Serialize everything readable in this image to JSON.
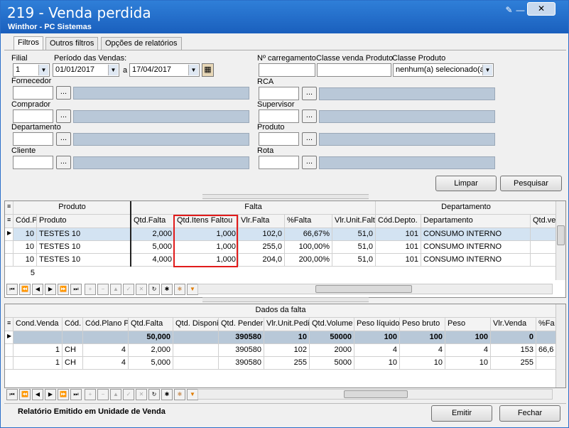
{
  "window": {
    "title": "219 - Venda perdida",
    "subtitle": "Winthor - PC Sistemas",
    "close_label": "✕"
  },
  "tabs": [
    {
      "label": "Filtros"
    },
    {
      "label": "Outros filtros"
    },
    {
      "label": "Opções de relatórios"
    }
  ],
  "filters": {
    "filial_label": "Filial",
    "filial_value": "1",
    "periodo_label": "Período das Vendas:",
    "data_inicio": "01/01/2017",
    "periodo_sep": "a",
    "data_fim": "17/04/2017",
    "fornecedor_label": "Fornecedor",
    "comprador_label": "Comprador",
    "departamento_label": "Departamento",
    "cliente_label": "Cliente",
    "carregamento_label": "Nº carregamento",
    "classe_venda_label": "Classe venda Produto",
    "classe_produto_label": "Classe Produto",
    "classe_produto_value": "nenhum(a) selecionado(a",
    "rca_label": "RCA",
    "supervisor_label": "Supervisor",
    "produto_label": "Produto",
    "rota_label": "Rota",
    "dots": "..."
  },
  "buttons": {
    "limpar": "Limpar",
    "pesquisar": "Pesquisar",
    "emitir": "Emitir",
    "fechar": "Fechar"
  },
  "grid1": {
    "band_produto": "Produto",
    "band_falta": "Falta",
    "band_departamento": "Departamento",
    "columns": [
      "Cód.P",
      "Produto",
      "Qtd.Falta",
      "Qtd.Itens Faltou",
      "Vlr.Falta",
      "%Falta",
      "Vlr.Unit.Falt",
      "Cód.Depto.",
      "Departamento",
      "Qtd.ve"
    ],
    "rows": [
      [
        "10",
        "TESTES 10",
        "2,000",
        "1,000",
        "102,0",
        "66,67%",
        "51,0",
        "101",
        "CONSUMO INTERNO",
        ""
      ],
      [
        "10",
        "TESTES 10",
        "5,000",
        "1,000",
        "255,0",
        "100,00%",
        "51,0",
        "101",
        "CONSUMO INTERNO",
        ""
      ],
      [
        "10",
        "TESTES 10",
        "4,000",
        "1,000",
        "204,0",
        "200,00%",
        "51,0",
        "101",
        "CONSUMO INTERNO",
        ""
      ]
    ],
    "footer_count": "5"
  },
  "grid2": {
    "band_title": "Dados da falta",
    "columns": [
      "Cond.Venda",
      "Cód.",
      "Cód.Plano P",
      "Qtd.Falta",
      "Qtd. Disponi",
      "Qtd. Pender",
      "Vlr.Unit.Pedi",
      "Qtd.Volume",
      "Peso líquido",
      "Peso bruto",
      "Peso",
      "Vlr.Venda",
      "%Fa"
    ],
    "summary": [
      "",
      "",
      "",
      "50,000",
      "",
      "390580",
      "10",
      "50000",
      "100",
      "100",
      "100",
      "0",
      ""
    ],
    "rows": [
      [
        "1",
        "CH",
        "4",
        "2,000",
        "",
        "390580",
        "102",
        "2000",
        "4",
        "4",
        "4",
        "153",
        "66,6"
      ],
      [
        "1",
        "CH",
        "4",
        "5,000",
        "",
        "390580",
        "255",
        "5000",
        "10",
        "10",
        "10",
        "255",
        ""
      ]
    ]
  },
  "footer": {
    "status": "Relatório Emitido em Unidade de Venda"
  }
}
